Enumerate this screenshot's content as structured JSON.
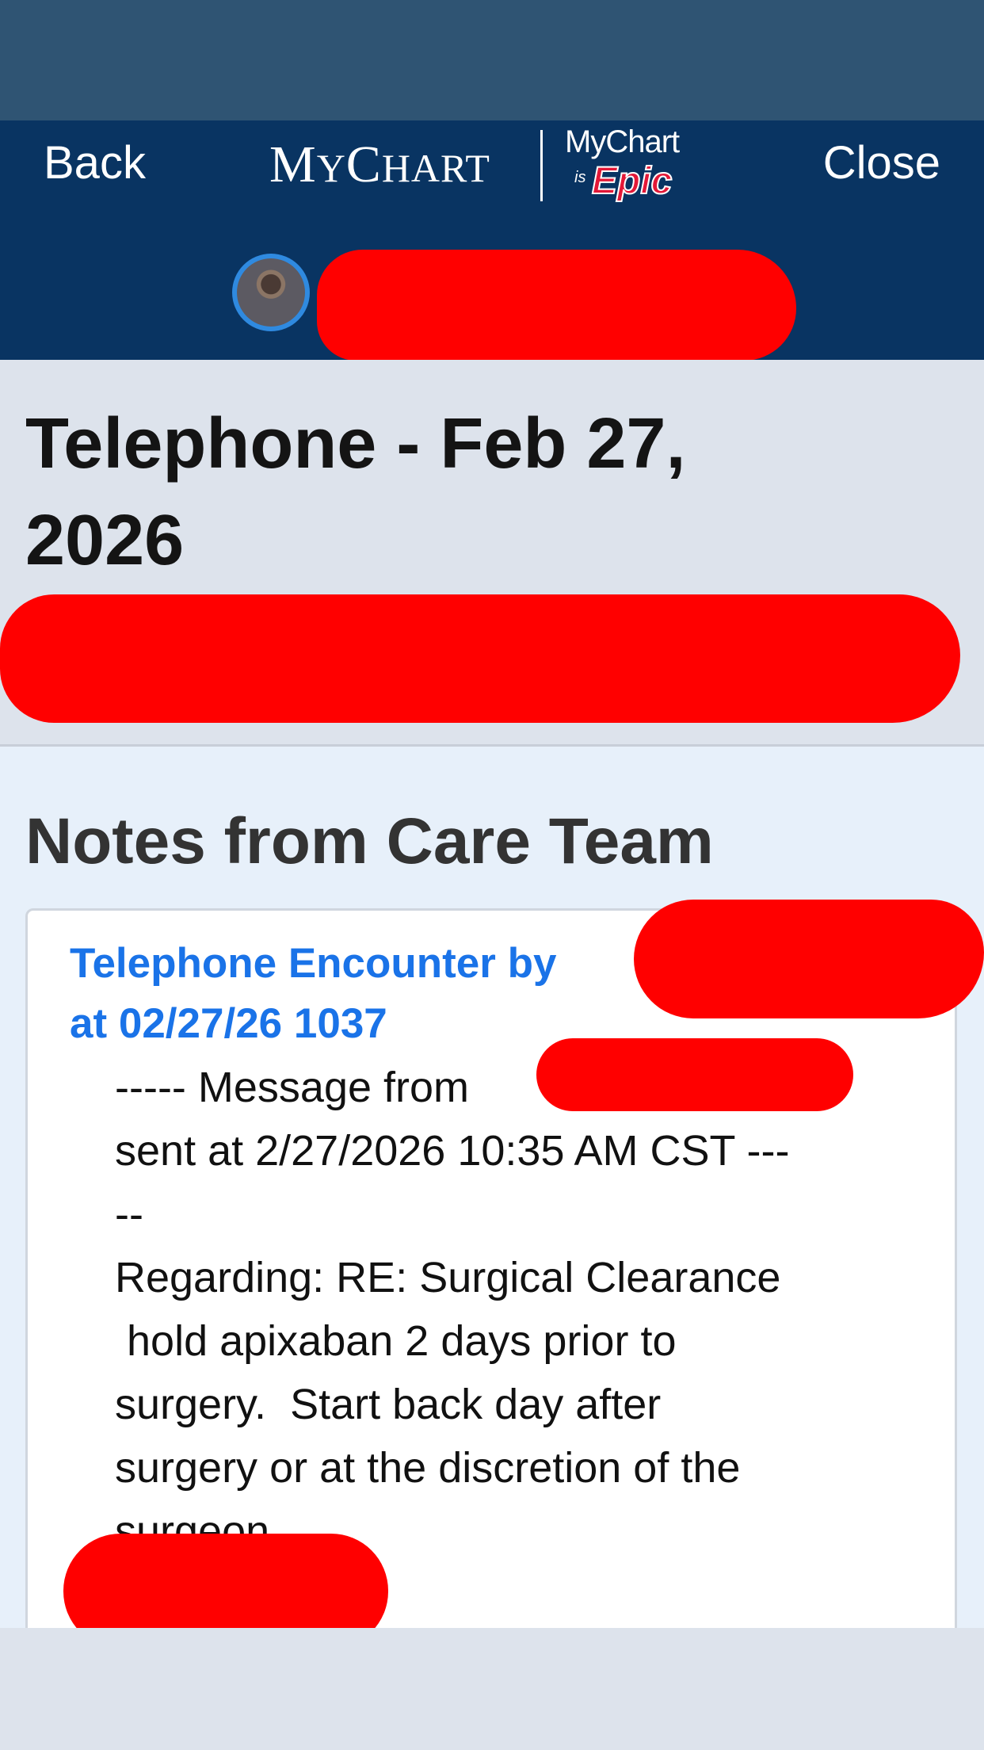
{
  "nav": {
    "back_label": "Back",
    "close_label": "Close",
    "brand_my": "M",
    "brand_y": "Y",
    "brand_c": "C",
    "brand_hart": "HART",
    "epic_mychart": "MyChart",
    "epic_is": "is",
    "epic_epic": "Epic"
  },
  "visit": {
    "title": "Telephone - Feb 27, 2026"
  },
  "notes": {
    "heading": "Notes from Care Team",
    "entry": {
      "title_line1": "Telephone Encounter by",
      "title_line2": "at 02/27/26 1037",
      "body": "----- Message from \nsent at 2/27/2026 10:35 AM CST ---\n--\nRegarding: RE: Surgical Clearance\n hold apixaban 2 days prior to\nsurgery.  Start back day after\nsurgery or at the discretion of the\nsurgeon."
    }
  },
  "colors": {
    "status_bar": "#2f5473",
    "nav_bar": "#093462",
    "link_blue": "#1a73e8",
    "redaction": "#ff0000"
  }
}
